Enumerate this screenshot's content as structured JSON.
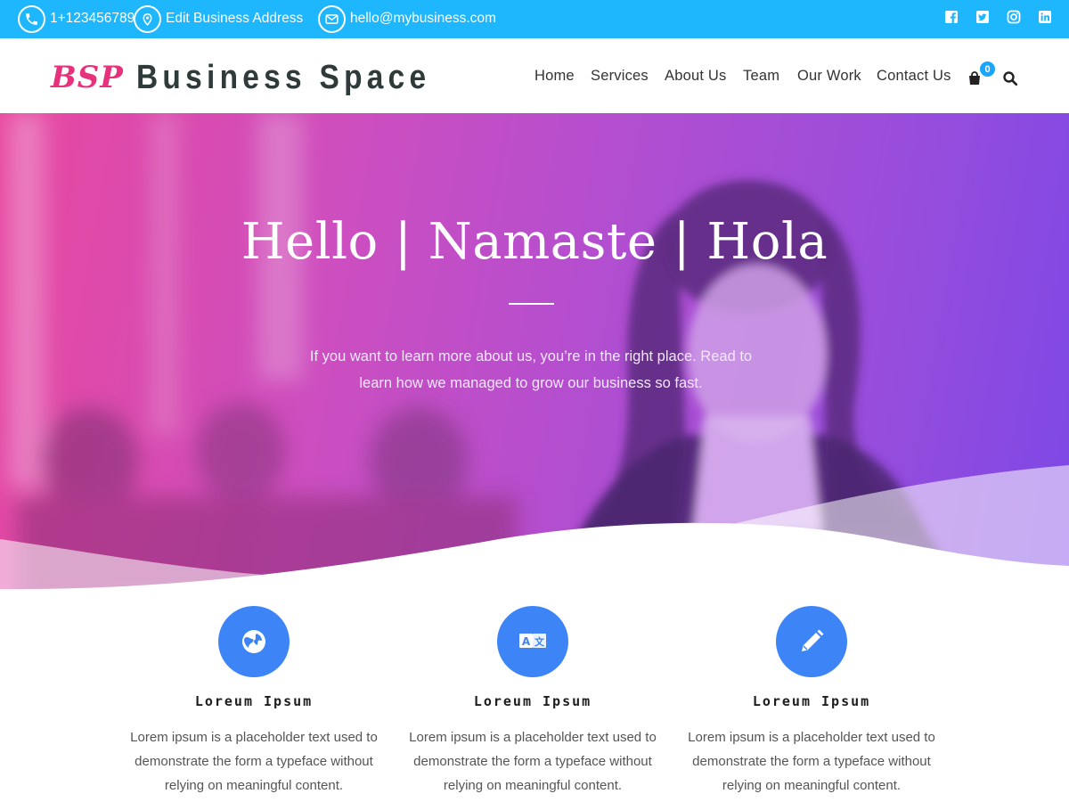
{
  "topbar": {
    "phone": "1+123456789",
    "address": "Edit Business Address",
    "email": "hello@mybusiness.com",
    "social_icons": [
      "facebook-icon",
      "twitter-icon",
      "instagram-icon",
      "linkedin-icon"
    ],
    "color": "#1eb6fc"
  },
  "header": {
    "logo_mark": "BSP",
    "logo_text": "Business Space",
    "nav": [
      "Home",
      "Services",
      "About Us",
      "Team",
      "Our Work",
      "Contact Us"
    ],
    "cart_count": "0",
    "cart_icon": "shopping-bag-icon",
    "search_icon": "search-icon"
  },
  "hero": {
    "title": "Hello | Namaste | Hola",
    "subtitle": "If you want to learn more about us, you’re in the right place. Read to learn how we managed to grow our business so fast.",
    "gradient": [
      "#e8489f",
      "#7d48e6"
    ]
  },
  "features": [
    {
      "icon": "globe-icon",
      "title": "Loreum Ipsum",
      "text": "Lorem ipsum is a placeholder text used to demonstrate the form a typeface without relying on meaningful content."
    },
    {
      "icon": "translate-icon",
      "title": "Loreum Ipsum",
      "text": "Lorem ipsum is a placeholder text used to demonstrate the form a typeface without relying on meaningful content."
    },
    {
      "icon": "pencil-icon",
      "title": "Loreum Ipsum",
      "text": "Lorem ipsum is a placeholder text used to demonstrate the form a typeface without relying on meaningful content."
    }
  ],
  "accent_color": "#3d84f7"
}
